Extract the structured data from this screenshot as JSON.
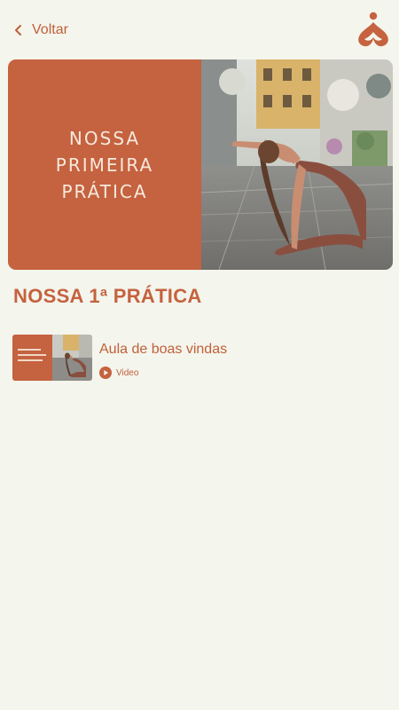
{
  "header": {
    "back_label": "Voltar"
  },
  "hero": {
    "title": "NOSSA PRIMEIRA PRÁTICA"
  },
  "module": {
    "title": "NOSSA 1ª PRÁTICA"
  },
  "lessons": [
    {
      "title": "Aula de boas vindas",
      "type": "Video"
    }
  ],
  "colors": {
    "background": "#f4f5ec",
    "accent": "#c5623f"
  }
}
